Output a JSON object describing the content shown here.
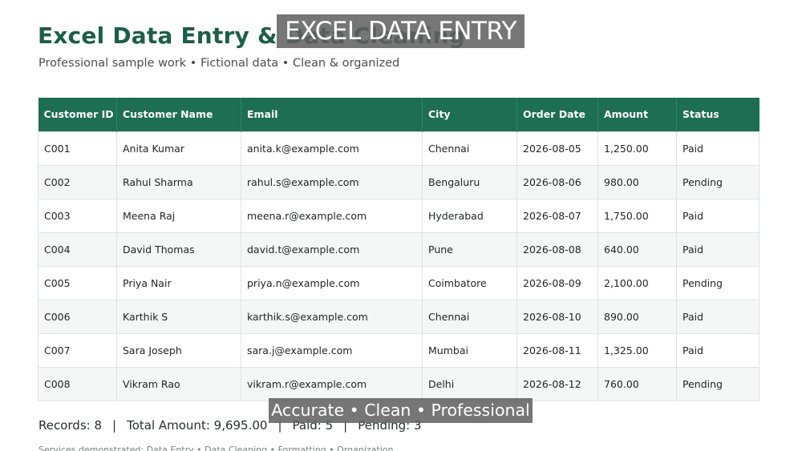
{
  "header": {
    "title": "Excel Data Entry & Data Cleaning",
    "subtitle": "Professional sample work • Fictional data • Clean & organized"
  },
  "overlay": {
    "top_text": "EXCEL DATA ENTRY",
    "bottom_text": "Accurate • Clean • Professional"
  },
  "table": {
    "columns": [
      "Customer ID",
      "Customer Name",
      "Email",
      "City",
      "Order Date",
      "Amount",
      "Status"
    ],
    "rows": [
      [
        "C001",
        "Anita Kumar",
        "anita.k@example.com",
        "Chennai",
        "2026-08-05",
        "1,250.00",
        "Paid"
      ],
      [
        "C002",
        "Rahul Sharma",
        "rahul.s@example.com",
        "Bengaluru",
        "2026-08-06",
        "980.00",
        "Pending"
      ],
      [
        "C003",
        "Meena Raj",
        "meena.r@example.com",
        "Hyderabad",
        "2026-08-07",
        "1,750.00",
        "Paid"
      ],
      [
        "C004",
        "David Thomas",
        "david.t@example.com",
        "Pune",
        "2026-08-08",
        "640.00",
        "Paid"
      ],
      [
        "C005",
        "Priya Nair",
        "priya.n@example.com",
        "Coimbatore",
        "2026-08-09",
        "2,100.00",
        "Pending"
      ],
      [
        "C006",
        "Karthik S",
        "karthik.s@example.com",
        "Chennai",
        "2026-08-10",
        "890.00",
        "Paid"
      ],
      [
        "C007",
        "Sara Joseph",
        "sara.j@example.com",
        "Mumbai",
        "2026-08-11",
        "1,325.00",
        "Paid"
      ],
      [
        "C008",
        "Vikram Rao",
        "vikram.r@example.com",
        "Delhi",
        "2026-08-12",
        "760.00",
        "Pending"
      ]
    ]
  },
  "summary": {
    "records": "Records: 8",
    "total": "Total Amount: 9,695.00",
    "paid": "Paid: 5",
    "pending": "Pending: 3",
    "separator": "|"
  },
  "footer": {
    "text": "Services demonstrated: Data Entry • Data Cleaning • Formatting • Organization"
  },
  "colors": {
    "header_green": "#1d6e52",
    "title_green": "#1d5e46",
    "overlay_gray": "#5f5f5f"
  }
}
